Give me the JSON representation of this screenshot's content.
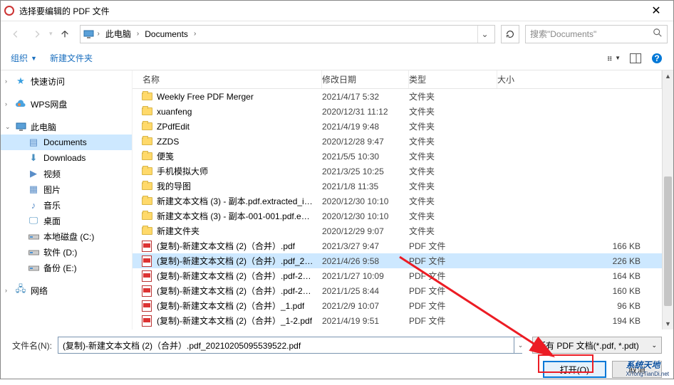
{
  "window": {
    "title": "选择要编辑的 PDF 文件"
  },
  "breadcrumb": {
    "root": "此电脑",
    "folder": "Documents"
  },
  "search": {
    "placeholder": "搜索\"Documents\""
  },
  "toolbar": {
    "organize": "组织",
    "new_folder": "新建文件夹"
  },
  "columns": {
    "name": "名称",
    "date": "修改日期",
    "type": "类型",
    "size": "大小"
  },
  "sidebar": {
    "quick": "快速访问",
    "wps": "WPS网盘",
    "thispc": "此电脑",
    "documents": "Documents",
    "downloads": "Downloads",
    "videos": "视频",
    "pictures": "图片",
    "music": "音乐",
    "desktop": "桌面",
    "localc": "本地磁盘 (C:)",
    "softd": "软件 (D:)",
    "backupe": "备份 (E:)",
    "network": "网络"
  },
  "type_labels": {
    "folder": "文件夹",
    "pdf": "PDF 文件"
  },
  "files": [
    {
      "icon": "folder",
      "name": "Weekly Free PDF Merger",
      "date": "2021/4/17 5:32",
      "type": "文件夹",
      "size": ""
    },
    {
      "icon": "folder",
      "name": "xuanfeng",
      "date": "2020/12/31 11:12",
      "type": "文件夹",
      "size": ""
    },
    {
      "icon": "folder",
      "name": "ZPdfEdit",
      "date": "2021/4/19 9:48",
      "type": "文件夹",
      "size": ""
    },
    {
      "icon": "folder",
      "name": "ZZDS",
      "date": "2020/12/28 9:47",
      "type": "文件夹",
      "size": ""
    },
    {
      "icon": "folder",
      "name": "便笺",
      "date": "2021/5/5 10:30",
      "type": "文件夹",
      "size": ""
    },
    {
      "icon": "folder",
      "name": "手机模拟大师",
      "date": "2021/3/25 10:25",
      "type": "文件夹",
      "size": ""
    },
    {
      "icon": "folder",
      "name": "我的导图",
      "date": "2021/1/8 11:35",
      "type": "文件夹",
      "size": ""
    },
    {
      "icon": "folder",
      "name": "新建文本文档 (3) - 副本.pdf.extracted_i…",
      "date": "2020/12/30 10:10",
      "type": "文件夹",
      "size": ""
    },
    {
      "icon": "folder",
      "name": "新建文本文档 (3) - 副本-001-001.pdf.e…",
      "date": "2020/12/30 10:10",
      "type": "文件夹",
      "size": ""
    },
    {
      "icon": "folder",
      "name": "新建文件夹",
      "date": "2020/12/29 9:07",
      "type": "文件夹",
      "size": ""
    },
    {
      "icon": "pdf",
      "name": "(复制)-新建文本文档 (2)（合并）.pdf",
      "date": "2021/3/27 9:47",
      "type": "PDF 文件",
      "size": "166 KB"
    },
    {
      "icon": "pdf",
      "name": "(复制)-新建文本文档 (2)（合并）.pdf_2…",
      "date": "2021/4/26 9:58",
      "type": "PDF 文件",
      "size": "226 KB",
      "selected": true
    },
    {
      "icon": "pdf",
      "name": "(复制)-新建文本文档 (2)（合并）.pdf-2…",
      "date": "2021/1/27 10:09",
      "type": "PDF 文件",
      "size": "164 KB"
    },
    {
      "icon": "pdf",
      "name": "(复制)-新建文本文档 (2)（合并）.pdf-2…",
      "date": "2021/1/25 8:44",
      "type": "PDF 文件",
      "size": "160 KB"
    },
    {
      "icon": "pdf",
      "name": "(复制)-新建文本文档 (2)（合并）_1.pdf",
      "date": "2021/2/9 10:07",
      "type": "PDF 文件",
      "size": "96 KB"
    },
    {
      "icon": "pdf",
      "name": "(复制)-新建文本文档 (2)（合并）_1-2.pdf",
      "date": "2021/4/19 9:51",
      "type": "PDF 文件",
      "size": "194 KB"
    }
  ],
  "filename": {
    "label": "文件名(N):",
    "value": "(复制)-新建文本文档 (2)（合并）.pdf_20210205095539522.pdf"
  },
  "filter": {
    "label": "所有 PDF 文档(*.pdf, *.pdt)"
  },
  "buttons": {
    "open": "打开(O)",
    "cancel": "取消"
  },
  "watermark": {
    "main": "系统天地",
    "sub": "XiTongTianDi.net"
  }
}
